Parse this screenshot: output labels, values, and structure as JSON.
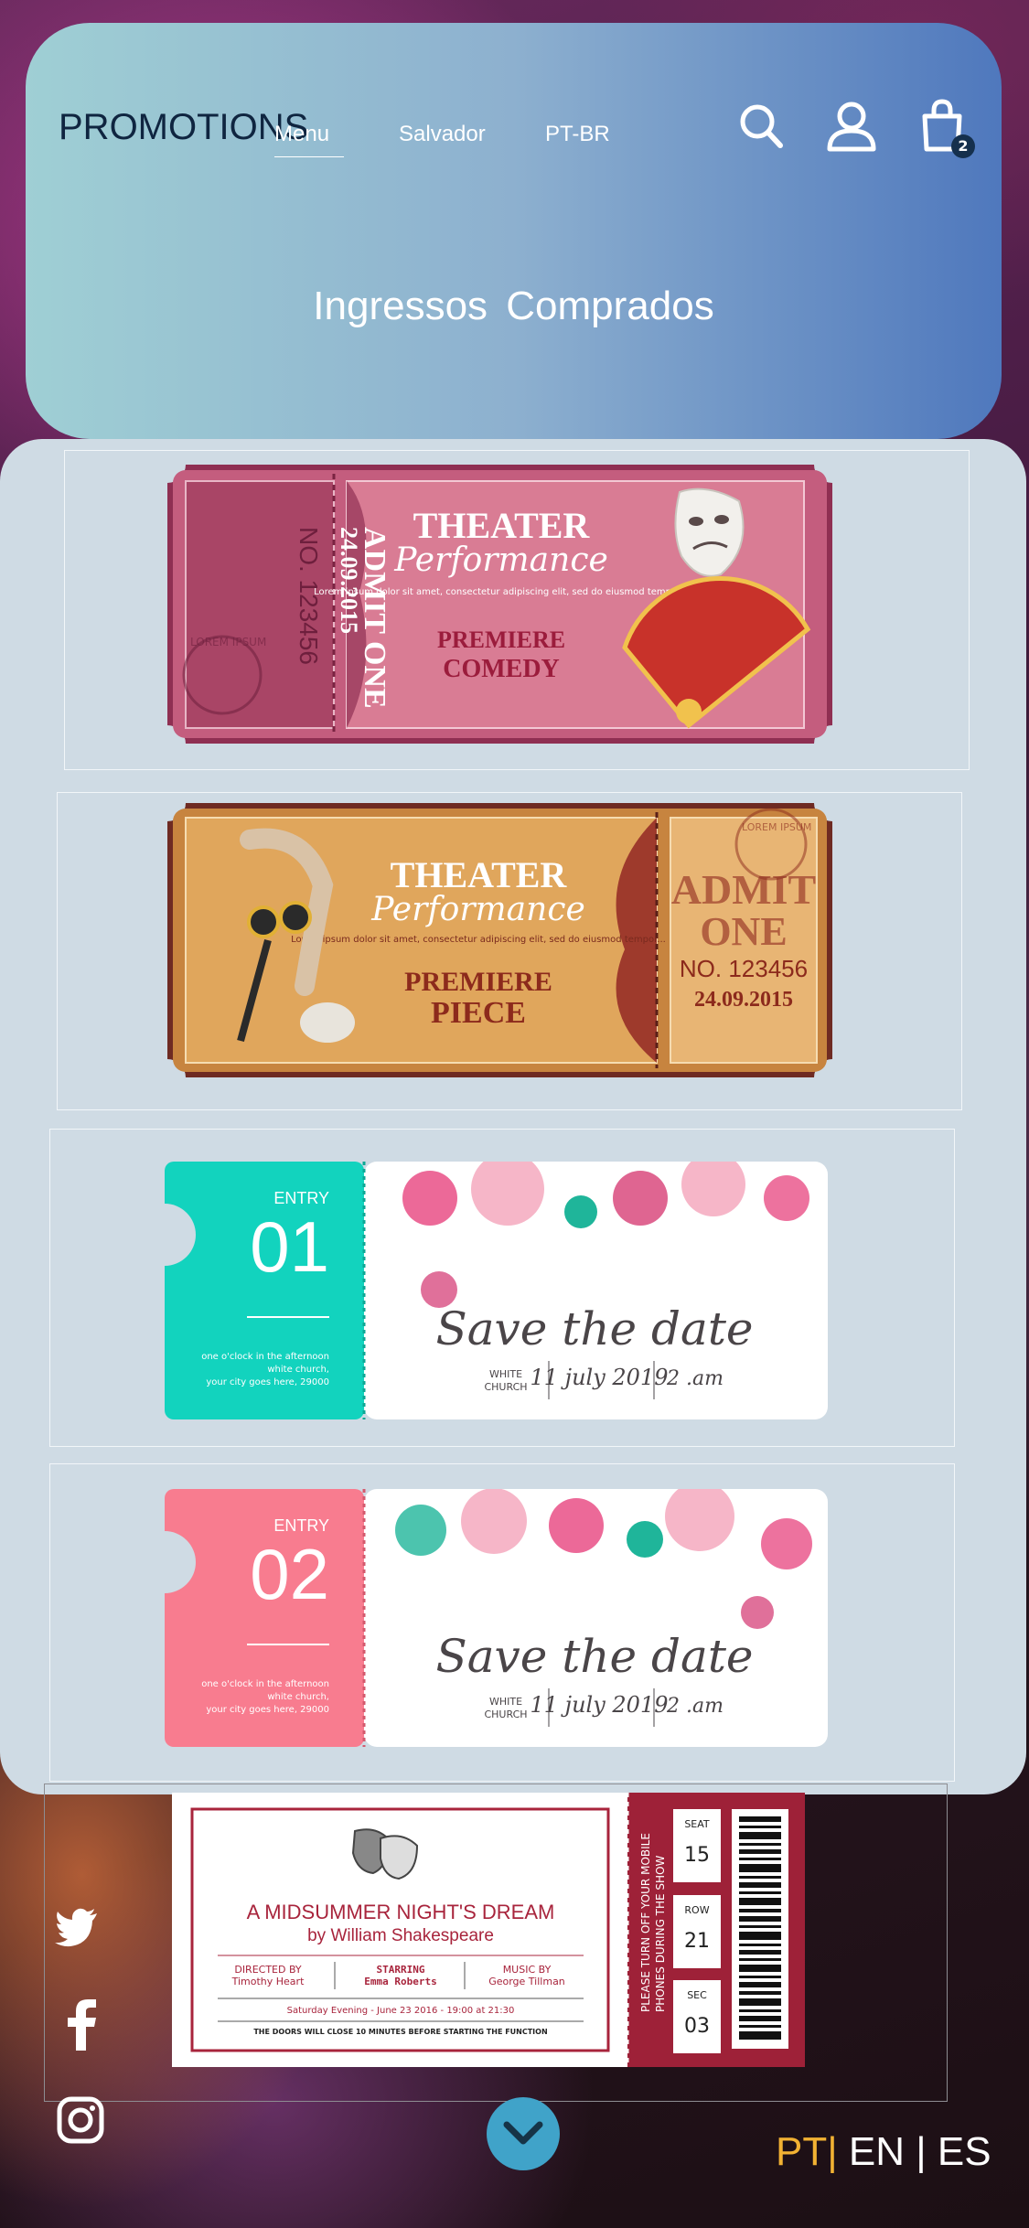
{
  "header": {
    "brand": "PROMOTIONS",
    "nav": {
      "menu": "Menu",
      "city": "Salvador",
      "language": "PT-BR"
    },
    "icons": [
      "search-icon",
      "user-icon",
      "shopping-bag-icon"
    ],
    "cart_count": "2",
    "title": "Ingressos  Comprados"
  },
  "tickets": [
    {
      "stub": {
        "admit": "ADMIT ONE",
        "date": "24.09.2015",
        "number": "NO. 123456",
        "stamp": "LOREM IPSUM"
      },
      "title_line1": "THEATER",
      "title_line2": "Performance",
      "body": "Lorem ipsum dolor sit amet, consectetur adipiscing elit, sed do eiusmod tempor...",
      "sub1": "PREMIERE",
      "sub2": "COMEDY"
    },
    {
      "title_line1": "THEATER",
      "title_line2": "Performance",
      "body": "Lorem ipsum dolor sit amet, consectetur adipiscing elit, sed do eiusmod tempor...",
      "sub1": "PREMIERE",
      "sub2": "PIECE",
      "stub": {
        "admit": "ADMIT",
        "one": "ONE",
        "number": "NO. 123456",
        "date": "24.09.2015",
        "stamp": "LOREM IPSUM"
      }
    },
    {
      "entry_label": "ENTRY",
      "entry_number": "01",
      "info_line1": "one o'clock in the afternoon",
      "info_line2": "white church,",
      "info_line3": "your city goes here, 29000",
      "headline": "Save the date",
      "place_line1": "WHITE",
      "place_line2": "CHURCH",
      "date": "11 july 2019",
      "time": "2 .am"
    },
    {
      "entry_label": "ENTRY",
      "entry_number": "02",
      "info_line1": "one o'clock in the afternoon",
      "info_line2": "white church,",
      "info_line3": "your city goes here, 29000",
      "headline": "Save the date",
      "place_line1": "WHITE",
      "place_line2": "CHURCH",
      "date": "11 july 2019",
      "time": "2 .am"
    },
    {
      "title": "A MIDSUMMER NIGHT'S DREAM",
      "author": "by William Shakespeare",
      "directed_label": "DIRECTED BY",
      "directed_name": "Timothy Heart",
      "starring_label": "STARRING",
      "starring_name": "Emma Roberts",
      "music_label": "MUSIC BY",
      "music_name": "George Tillman",
      "when": "Saturday Evening - June 23 2016 - 19:00 at 21:30",
      "notice": "THE DOORS WILL CLOSE 10 MINUTES BEFORE STARTING THE FUNCTION",
      "vertical_line1": "PLEASE TURN OFF YOUR MOBILE",
      "vertical_line2": "PHONES DURING THE SHOW",
      "seat_label": "SEAT",
      "seat": "15",
      "row_label": "ROW",
      "row": "21",
      "sec_label": "SEC",
      "sec": "03"
    }
  ],
  "social": [
    "twitter-icon",
    "facebook-icon",
    "instagram-icon"
  ],
  "languages": {
    "pt": "PT",
    "en": "EN",
    "es": "ES"
  },
  "colors": {
    "accent": "#f2b233",
    "scroll_button": "#40a3c9",
    "header_start": "#9fcfd4",
    "header_end": "#4f78bd"
  }
}
